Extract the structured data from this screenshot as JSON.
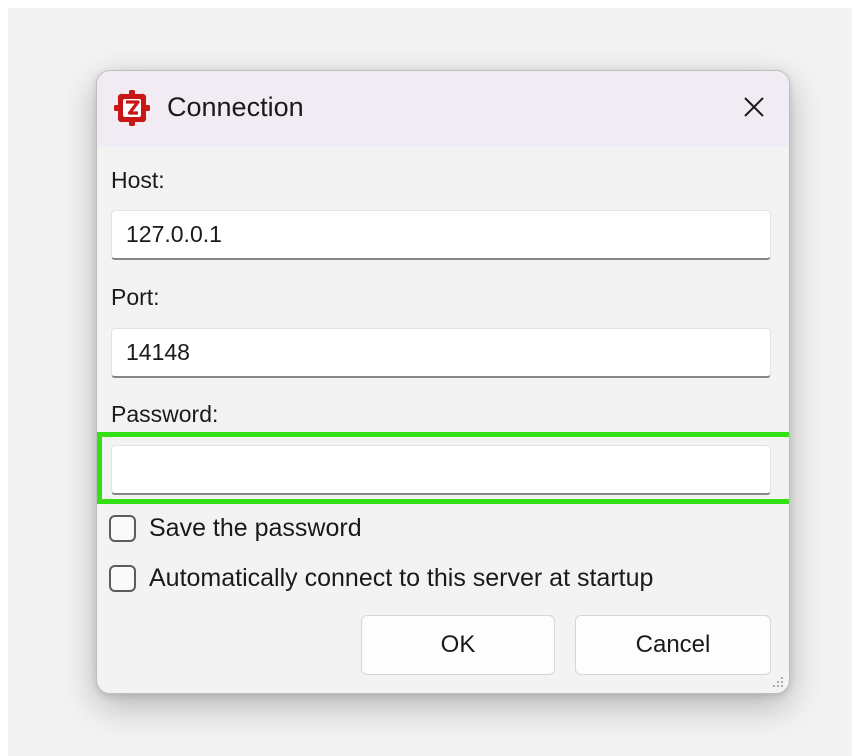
{
  "dialog": {
    "title": "Connection",
    "close_label": "Close",
    "icon": "filezilla-server-icon",
    "accent_color": "#c81616",
    "highlight_color": "#33e014"
  },
  "form": {
    "host_label": "Host:",
    "host_value": "127.0.0.1",
    "port_label": "Port:",
    "port_value": "14148",
    "password_label": "Password:",
    "password_value": "",
    "save_password_label": "Save the password",
    "save_password_checked": false,
    "auto_connect_label": "Automatically connect to this server at startup",
    "auto_connect_checked": false
  },
  "buttons": {
    "ok_label": "OK",
    "cancel_label": "Cancel"
  }
}
